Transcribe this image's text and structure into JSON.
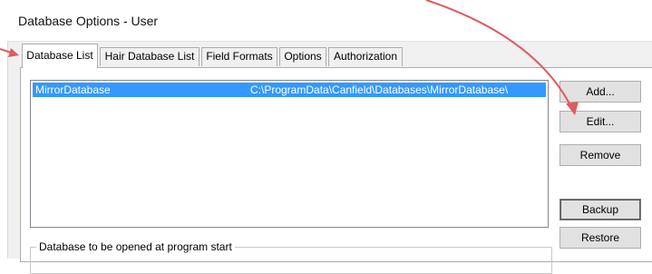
{
  "window": {
    "title": "Database Options - User"
  },
  "tabs": [
    {
      "label": "Database List",
      "active": true
    },
    {
      "label": "Hair Database List",
      "active": false
    },
    {
      "label": "Field Formats",
      "active": false
    },
    {
      "label": "Options",
      "active": false
    },
    {
      "label": "Authorization",
      "active": false
    }
  ],
  "database_list": {
    "rows": [
      {
        "name": "MirrorDatabase",
        "path": "C:\\ProgramData\\Canfield\\Databases\\MirrorDatabase\\",
        "selected": true
      }
    ]
  },
  "buttons": {
    "add": "Add...",
    "edit": "Edit...",
    "remove": "Remove",
    "backup": "Backup",
    "restore": "Restore"
  },
  "startup_group": {
    "label": "Database to be opened at program start"
  },
  "annotation": {
    "arrow_color": "#e05a5f"
  }
}
